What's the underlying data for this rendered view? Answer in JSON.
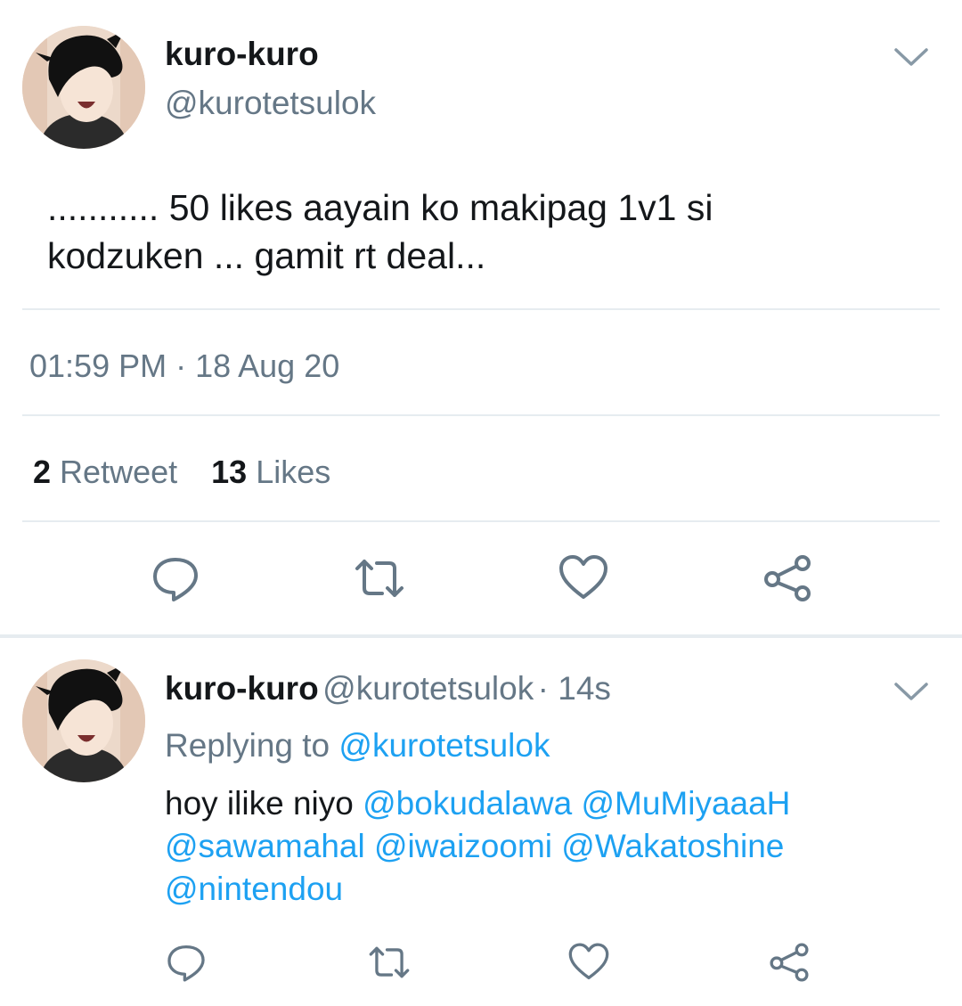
{
  "main_tweet": {
    "display_name": "kuro-kuro",
    "handle": "@kurotetsulok",
    "text_line1": "........... 50 likes aayain ko makipag 1v1 si",
    "text_line2": "kodzuken ... gamit rt deal...",
    "timestamp": "01:59 PM · 18 Aug 20",
    "retweet_count": "2",
    "retweet_label": "Retweet",
    "likes_count": "13",
    "likes_label": "Likes"
  },
  "reply_tweet": {
    "display_name": "kuro-kuro",
    "handle": "@kurotetsulok",
    "time": "· 14s",
    "replying_prefix": "Replying to",
    "replying_handle": "@kurotetsulok",
    "text_prefix": "hoy ilike niyo",
    "mentions": [
      "@bokudalawa",
      "@MuMiyaaaH",
      "@sawamahal",
      "@iwaizoomi",
      "@Wakatoshine",
      "@nintendou"
    ]
  },
  "icons": {
    "menu": "chevron-down-icon",
    "reply": "reply-icon",
    "retweet": "retweet-icon",
    "like": "heart-icon",
    "share": "share-icon"
  },
  "colors": {
    "text": "#14171a",
    "muted": "#657786",
    "link": "#1da1f2",
    "divider": "#e6ecf0"
  }
}
